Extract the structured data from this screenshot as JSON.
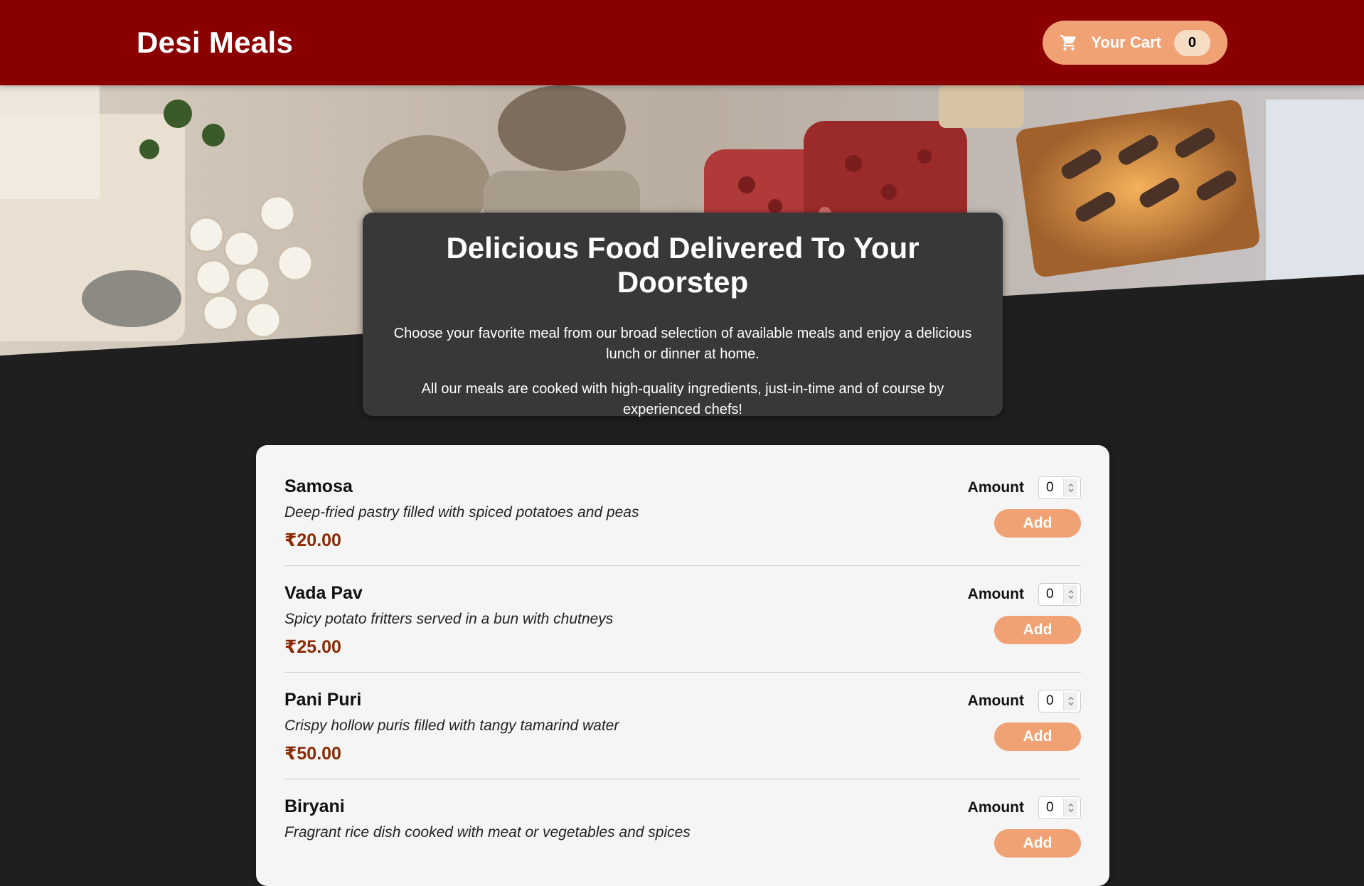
{
  "header": {
    "brand": "Desi Meals",
    "cart_label": "Your Cart",
    "cart_count": "0",
    "cart_icon": "shopping-cart-icon"
  },
  "hero": {
    "image_alt": "A table full of delicious food"
  },
  "summary": {
    "title": "Delicious Food Delivered To Your Doorstep",
    "paragraph1": "Choose your favorite meal from our broad selection of available meals and enjoy a delicious lunch or dinner at home.",
    "paragraph2": "All our meals are cooked with high-quality ingredients, just-in-time and of course by experienced chefs!"
  },
  "meals": [
    {
      "name": "Samosa",
      "description": "Deep-fried pastry filled with spiced potatoes and peas",
      "price": "₹20.00",
      "amount_label": "Amount",
      "amount": "0",
      "add_label": "Add"
    },
    {
      "name": "Vada Pav",
      "description": "Spicy potato fritters served in a bun with chutneys",
      "price": "₹25.00",
      "amount_label": "Amount",
      "amount": "0",
      "add_label": "Add"
    },
    {
      "name": "Pani Puri",
      "description": "Crispy hollow puris filled with tangy tamarind water",
      "price": "₹50.00",
      "amount_label": "Amount",
      "amount": "0",
      "add_label": "Add"
    },
    {
      "name": "Biryani",
      "description": "Fragrant rice dish cooked with meat or vegetables and spices",
      "price": "",
      "amount_label": "Amount",
      "amount": "0",
      "add_label": "Add"
    }
  ],
  "colors": {
    "header_bg": "#8a0000",
    "accent": "#f0a275",
    "price": "#8a2b06",
    "page_bg": "#1f1f1f",
    "summary_bg": "#383838"
  }
}
